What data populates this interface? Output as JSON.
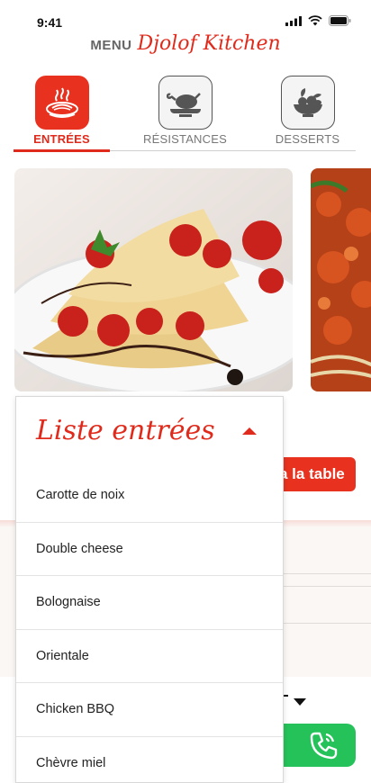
{
  "status_bar": {
    "time": "9:41"
  },
  "header": {
    "menu_word": "MENU",
    "brand": "Djolof Kitchen"
  },
  "colors": {
    "accent": "#e02b1c",
    "call_green": "#25c25a"
  },
  "tabs": [
    {
      "label": "ENTRÉES",
      "icon": "spaghetti-plate-icon",
      "active": true
    },
    {
      "label": "RÉSISTANCES",
      "icon": "roast-chicken-icon",
      "active": false
    },
    {
      "label": "DESSERTS",
      "icon": "fruit-bowl-icon",
      "active": false
    }
  ],
  "carousel": {
    "items": [
      {
        "image": "strawberry-crepes-photo"
      },
      {
        "image": "tomato-pasta-photo"
      }
    ]
  },
  "table_button": {
    "label": "a la table"
  },
  "dropdown": {
    "title": "Liste entrées",
    "expanded": true,
    "items": [
      "Carotte de noix",
      "Double cheese",
      "Bolognaise",
      "Orientale",
      "Chicken BBQ",
      "Chèvre miel"
    ]
  }
}
